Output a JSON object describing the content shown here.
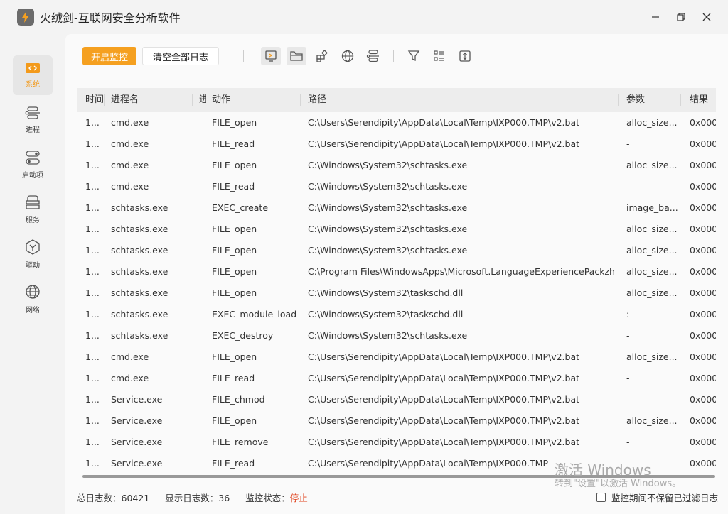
{
  "window": {
    "title": "火绒剑-互联网安全分析软件",
    "colors": {
      "accent": "#f5a020",
      "warn": "#e0401a"
    }
  },
  "sidebar": {
    "items": [
      {
        "label": "系统",
        "icon": "code-icon",
        "active": true
      },
      {
        "label": "进程",
        "icon": "process-icon"
      },
      {
        "label": "启动项",
        "icon": "toggle-icon"
      },
      {
        "label": "服务",
        "icon": "service-icon"
      },
      {
        "label": "驱动",
        "icon": "driver-icon"
      },
      {
        "label": "网络",
        "icon": "globe-icon"
      }
    ]
  },
  "toolbar": {
    "start_label": "开启监控",
    "clear_label": "清空全部日志"
  },
  "table": {
    "columns": [
      "时间",
      "进程名",
      "进",
      "动作",
      "路径",
      "参数",
      "结果"
    ],
    "rows": [
      [
        "1...",
        "cmd.exe",
        "",
        "FILE_open",
        "C:\\Users\\Serendipity\\AppData\\Local\\Temp\\IXP000.TMP\\v2.bat",
        "alloc_size...",
        "0x000"
      ],
      [
        "1...",
        "cmd.exe",
        "",
        "FILE_read",
        "C:\\Users\\Serendipity\\AppData\\Local\\Temp\\IXP000.TMP\\v2.bat",
        "-",
        "0x000"
      ],
      [
        "1...",
        "cmd.exe",
        "",
        "FILE_open",
        "C:\\Windows\\System32\\schtasks.exe",
        "alloc_size...",
        "0x000"
      ],
      [
        "1...",
        "cmd.exe",
        "",
        "FILE_read",
        "C:\\Windows\\System32\\schtasks.exe",
        "-",
        "0x000"
      ],
      [
        "1...",
        "schtasks.exe",
        "",
        "EXEC_create",
        "C:\\Windows\\System32\\schtasks.exe",
        "image_ba...",
        "0x000"
      ],
      [
        "1...",
        "schtasks.exe",
        "",
        "FILE_open",
        "C:\\Windows\\System32\\schtasks.exe",
        "alloc_size...",
        "0x000"
      ],
      [
        "1...",
        "schtasks.exe",
        "",
        "FILE_open",
        "C:\\Windows\\System32\\schtasks.exe",
        "alloc_size...",
        "0x000"
      ],
      [
        "1...",
        "schtasks.exe",
        "",
        "FILE_open",
        "C:\\Program Files\\WindowsApps\\Microsoft.LanguageExperiencePackzh-...",
        "alloc_size...",
        "0x000"
      ],
      [
        "1...",
        "schtasks.exe",
        "",
        "FILE_open",
        "C:\\Windows\\System32\\taskschd.dll",
        "alloc_size...",
        "0x000"
      ],
      [
        "1...",
        "schtasks.exe",
        "",
        "EXEC_module_load",
        "C:\\Windows\\System32\\taskschd.dll",
        ":",
        "0x000"
      ],
      [
        "1...",
        "schtasks.exe",
        "",
        "EXEC_destroy",
        "C:\\Windows\\System32\\schtasks.exe",
        "-",
        "0x000"
      ],
      [
        "1...",
        "cmd.exe",
        "",
        "FILE_open",
        "C:\\Users\\Serendipity\\AppData\\Local\\Temp\\IXP000.TMP\\v2.bat",
        "alloc_size...",
        "0x000"
      ],
      [
        "1...",
        "cmd.exe",
        "",
        "FILE_read",
        "C:\\Users\\Serendipity\\AppData\\Local\\Temp\\IXP000.TMP\\v2.bat",
        "-",
        "0x000"
      ],
      [
        "1...",
        "Service.exe",
        "",
        "FILE_chmod",
        "C:\\Users\\Serendipity\\AppData\\Local\\Temp\\IXP000.TMP\\v2.bat",
        "-",
        "0x000"
      ],
      [
        "1...",
        "Service.exe",
        "",
        "FILE_open",
        "C:\\Users\\Serendipity\\AppData\\Local\\Temp\\IXP000.TMP\\v2.bat",
        "alloc_size...",
        "0x000"
      ],
      [
        "1...",
        "Service.exe",
        "",
        "FILE_remove",
        "C:\\Users\\Serendipity\\AppData\\Local\\Temp\\IXP000.TMP\\v2.bat",
        "-",
        "0x000"
      ],
      [
        "1...",
        "Service.exe",
        "",
        "FILE_read",
        "C:\\Users\\Serendipity\\AppData\\Local\\Temp\\IXP000.TMP",
        "-",
        "0x000"
      ]
    ]
  },
  "status": {
    "total_label": "总日志数：",
    "total_value": "60421",
    "shown_label": "显示日志数：",
    "shown_value": "36",
    "monitor_label": "监控状态：",
    "monitor_value": "停止",
    "checkbox_label": "监控期间不保留已过滤日志"
  },
  "watermark": {
    "line1": "激活 Windows",
    "line2": "转到\"设置\"以激活 Windows。"
  }
}
